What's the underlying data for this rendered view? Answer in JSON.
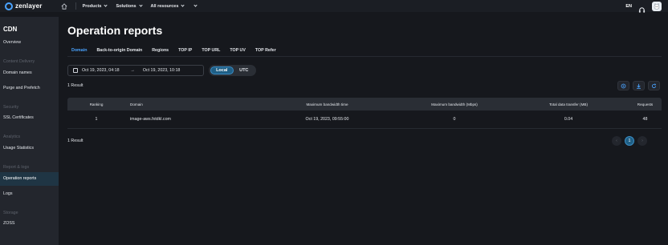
{
  "topbar": {
    "brand": "zenlayer",
    "nav": [
      {
        "label": "Products"
      },
      {
        "label": "Solutions"
      },
      {
        "label": "All resources"
      }
    ],
    "lang": "EN"
  },
  "sidebar": {
    "title": "CDN",
    "items": {
      "overview": "Overview",
      "domain_names": "Domain names",
      "purge": "Purge and Prefetch",
      "ssl": "SSL Certificates",
      "usage": "Usage Statistics",
      "operation_reports": "Operation reports",
      "logs": "Logs",
      "zoss": "ZOSS"
    },
    "sections": {
      "content_delivery": "Content Delivery",
      "security": "Security",
      "analytics": "Analytics",
      "report_logs": "Report & logs",
      "storage": "Storage"
    }
  },
  "main": {
    "title": "Operation reports",
    "tabs": [
      "Domain",
      "Back-to-origin Domain",
      "Regions",
      "TOP IP",
      "TOP URL",
      "TOP UV",
      "TOP Refer"
    ],
    "date_start": "Oct 19, 2023, 04:18",
    "date_end": "Oct 19, 2023, 10:18",
    "arrow": "→",
    "tz_local": "Local",
    "tz_utc": "UTC",
    "result_top": "1 Result",
    "result_bottom": "1 Result",
    "table": {
      "headers": [
        "Ranking",
        "Domain",
        "Maximum bandwidth time",
        "Maximum bandwidth (Mbps)",
        "Total data transfer (MB)",
        "Requests"
      ],
      "rows": [
        [
          "1",
          "image-aws.fxtdkl.com",
          "Oct 19, 2023, 09:55:00",
          "0",
          "0.04",
          "48"
        ]
      ]
    },
    "pager": {
      "prev": "‹",
      "page": "1",
      "next": "›"
    }
  }
}
